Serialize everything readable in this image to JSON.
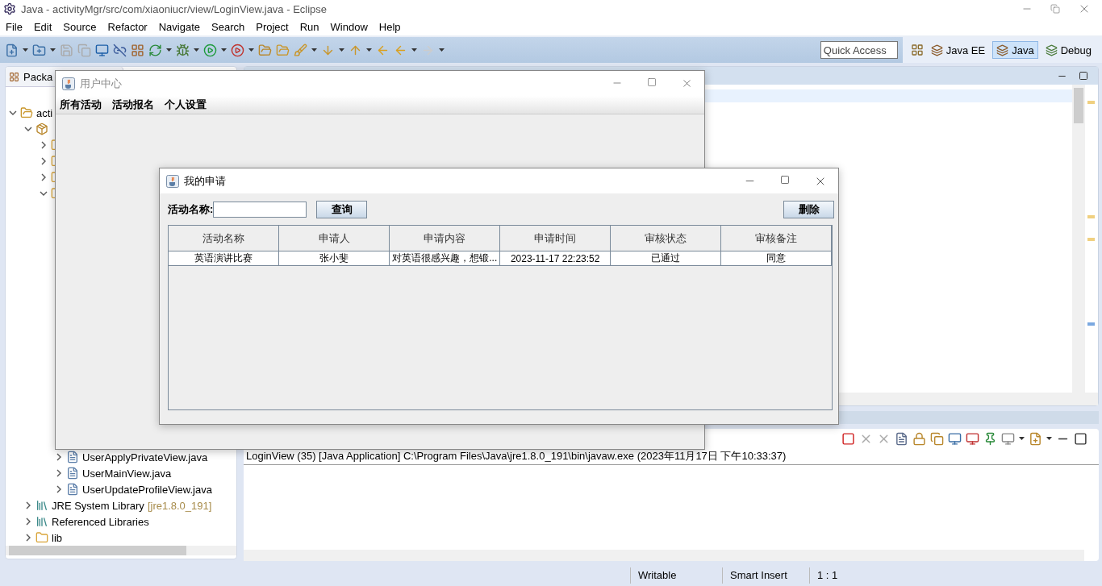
{
  "eclipse": {
    "title": "Java - activityMgr/src/com/xiaoniucr/view/LoginView.java - Eclipse",
    "menu": [
      "File",
      "Edit",
      "Source",
      "Refactor",
      "Navigate",
      "Search",
      "Project",
      "Run",
      "Window",
      "Help"
    ],
    "quick_access": {
      "placeholder": "Quick Access"
    },
    "perspectives": [
      {
        "label": "Java EE",
        "selected": false
      },
      {
        "label": "Java",
        "selected": true
      },
      {
        "label": "Debug",
        "selected": false
      }
    ],
    "explorer": {
      "tab": "Packa",
      "tree": [
        {
          "label": "acti",
          "kind": "project",
          "expanded": true,
          "children": [
            {
              "kind": "package",
              "expanded": true,
              "children": [
                {
                  "kind": "folder",
                  "expanded": false
                },
                {
                  "kind": "folder",
                  "expanded": false
                },
                {
                  "kind": "folder",
                  "expanded": false
                },
                {
                  "kind": "folder",
                  "expanded": true,
                  "children": [
                    {
                      "label": "UserApplyPrivateView.java",
                      "kind": "file",
                      "expanded": false
                    },
                    {
                      "label": "UserMainView.java",
                      "kind": "file",
                      "expanded": false
                    },
                    {
                      "label": "UserUpdateProfileView.java",
                      "kind": "file",
                      "expanded": false
                    }
                  ]
                }
              ]
            },
            {
              "label": "JRE System Library",
              "suffix": "[jre1.8.0_191]",
              "kind": "library",
              "expanded": false
            },
            {
              "label": "Referenced Libraries",
              "kind": "library",
              "expanded": false
            },
            {
              "label": "lib",
              "kind": "folder",
              "expanded": false
            }
          ]
        }
      ]
    },
    "console": {
      "header": "LoginView (35) [Java Application] C:\\Program Files\\Java\\jre1.8.0_191\\bin\\javaw.exe (2023年11月17日 下午10:33:37)"
    },
    "status_bar": [
      "Writable",
      "Smart Insert",
      "1 : 1"
    ]
  },
  "user_center": {
    "title": "用户中心",
    "active": false,
    "menu": [
      "所有活动",
      "活动报名",
      "个人设置"
    ]
  },
  "dialog": {
    "title": "我的申请",
    "active": true,
    "search_label": "活动名称:",
    "search_button": "查询",
    "delete_button": "删除",
    "table": {
      "columns": [
        "活动名称",
        "申请人",
        "申请内容",
        "申请时间",
        "审核状态",
        "审核备注"
      ],
      "rows": [
        [
          "英语演讲比赛",
          "张小斐",
          "对英语很感兴趣，想锻...",
          "2023-11-17 22:23:52",
          "已通过",
          "同意"
        ]
      ]
    }
  }
}
